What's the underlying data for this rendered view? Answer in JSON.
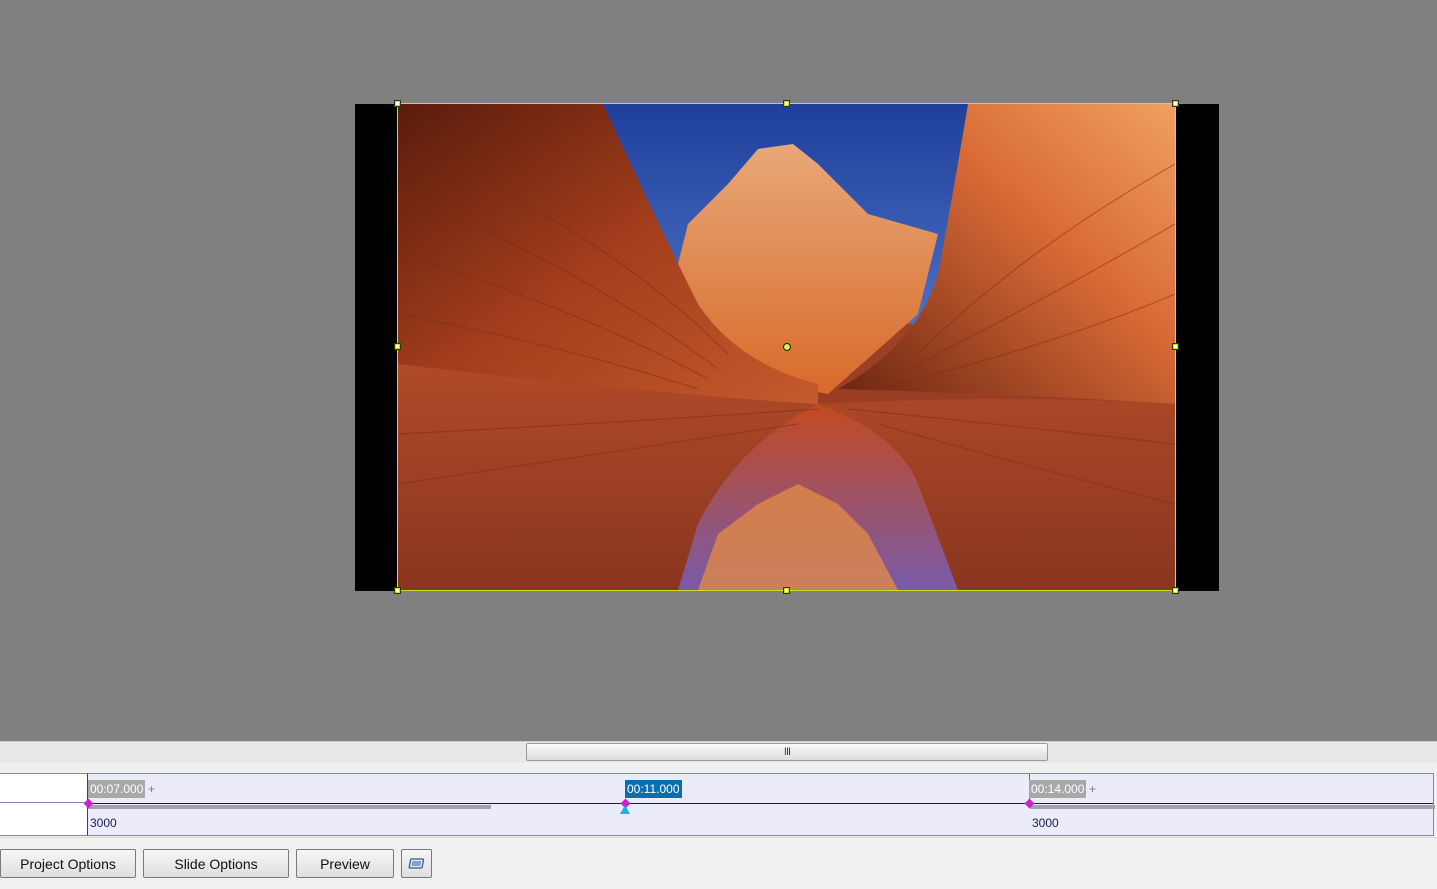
{
  "stage": {
    "image_description_icon": "canyon-photo",
    "selection_color": "#c6e020"
  },
  "splitter": {
    "grip": "III"
  },
  "timeline": {
    "keyframes": [
      {
        "time": "00:07.000",
        "value": "3000",
        "active": false,
        "plus": "+"
      },
      {
        "time": "00:11.000",
        "active": true
      },
      {
        "time": "00:14.000",
        "value": "3000",
        "active": false,
        "plus": "+"
      }
    ],
    "accent_color": "#0a6fb0",
    "keyframe_color": "#cc22cc",
    "playhead_color": "#1ab0e8"
  },
  "toolbar": {
    "project_options_label": "Project Options",
    "slide_options_label": "Slide Options",
    "preview_label": "Preview",
    "fullscreen_icon": "window-icon"
  }
}
